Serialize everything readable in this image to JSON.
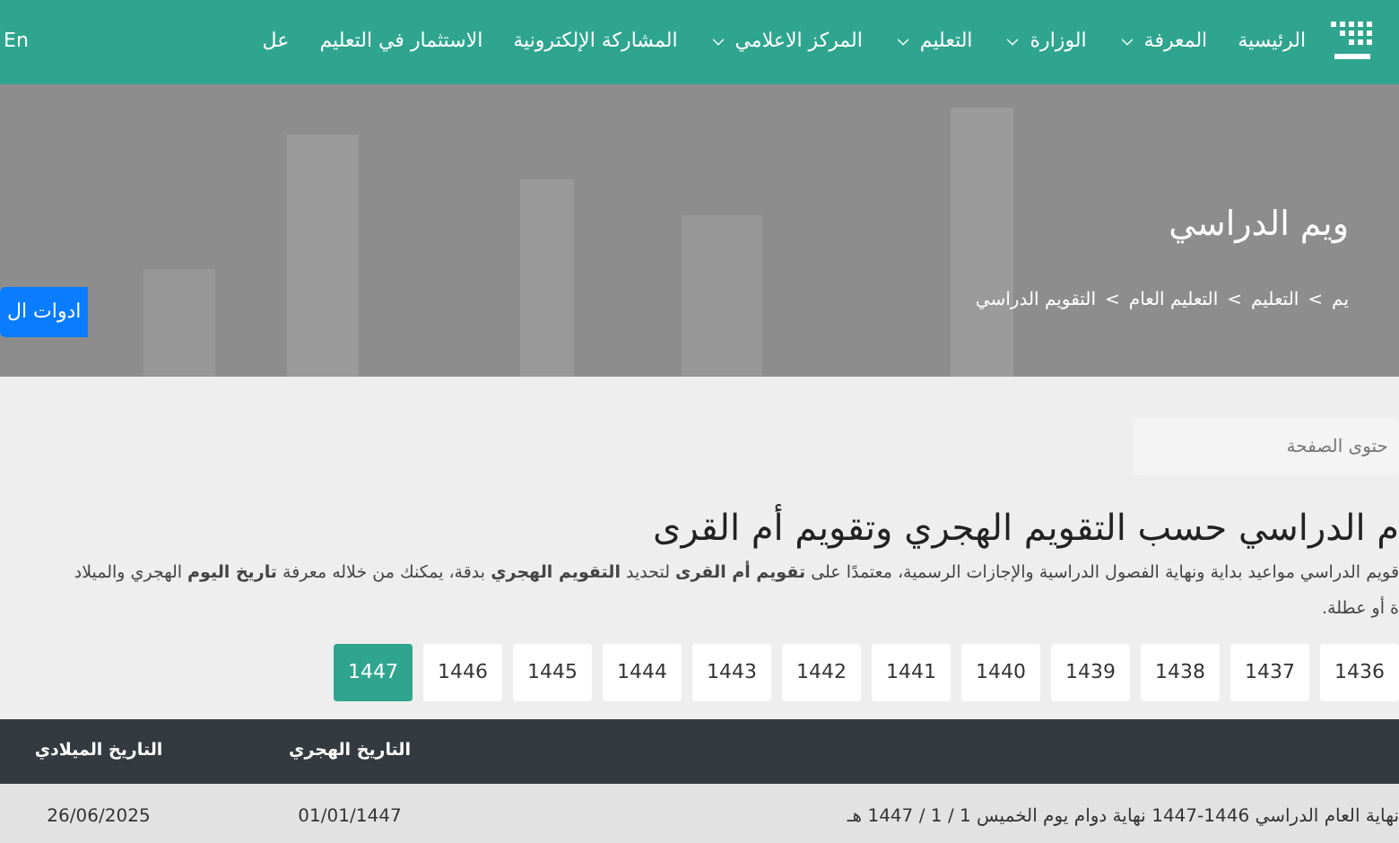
{
  "nav": {
    "items": [
      {
        "label": "الرئيسية",
        "dropdown": false
      },
      {
        "label": "المعرفة",
        "dropdown": true
      },
      {
        "label": "الوزارة",
        "dropdown": true
      },
      {
        "label": "التعليم",
        "dropdown": true
      },
      {
        "label": "المركز الاعلامي",
        "dropdown": true
      },
      {
        "label": "المشاركة الإلكترونية",
        "dropdown": false
      },
      {
        "label": "الاستثمار في التعليم",
        "dropdown": false
      },
      {
        "label": "عل",
        "dropdown": false
      }
    ],
    "language": "En"
  },
  "hero": {
    "title": "ويم الدراسي",
    "breadcrumb": [
      "يم",
      "التعليم",
      "التعليم العام",
      "التقويم الدراسي"
    ],
    "separator": ">",
    "button": "ادوات ال"
  },
  "search": {
    "placeholder": "حتوى الصفحة"
  },
  "heading": "م الدراسي حسب التقويم الهجري وتقويم أم القرى",
  "intro": [
    "قويم الدراسي مواعيد بداية ونهاية الفصول الدراسية والإجازات الرسمية، معتمدًا على **تقويم أم القرى** لتحديد **التقويم الهجري** بدقة، يمكنك من خلاله معرفة **تاريخ اليوم** الهجري والميلاد",
    "ة أو عطلة."
  ],
  "years": [
    {
      "label": "1436",
      "selected": false
    },
    {
      "label": "1437",
      "selected": false
    },
    {
      "label": "1438",
      "selected": false
    },
    {
      "label": "1439",
      "selected": false
    },
    {
      "label": "1440",
      "selected": false
    },
    {
      "label": "1441",
      "selected": false
    },
    {
      "label": "1442",
      "selected": false
    },
    {
      "label": "1443",
      "selected": false
    },
    {
      "label": "1444",
      "selected": false
    },
    {
      "label": "1445",
      "selected": false
    },
    {
      "label": "1446",
      "selected": false
    },
    {
      "label": "1447",
      "selected": true
    }
  ],
  "table": {
    "columns": [
      "التاريخ الهجري",
      "التاريخ الميلادي"
    ],
    "rows": [
      {
        "event": "نهاية العام الدراسي 1446-1447 نهاية دوام يوم الخميس 1 / 1 / 1447 هـ",
        "hijri": "01/01/1447",
        "gregorian": "26/06/2025"
      }
    ]
  }
}
